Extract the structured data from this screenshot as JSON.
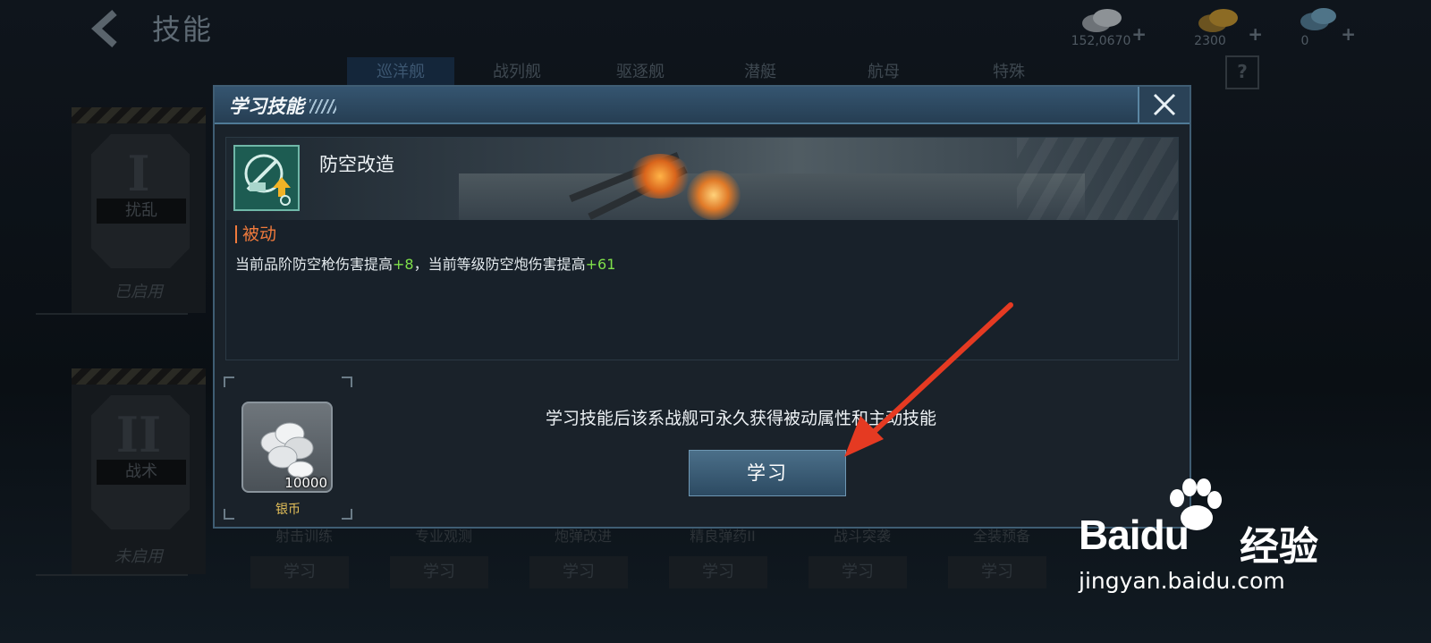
{
  "header": {
    "title": "技能",
    "currencies": [
      {
        "name": "silver",
        "amount": "152,0670",
        "plus": "+",
        "color": "#c7cacc"
      },
      {
        "name": "gold",
        "amount": "2300",
        "plus": "+",
        "color": "#d9a428"
      },
      {
        "name": "diamond",
        "amount": "0",
        "plus": "+",
        "color": "#7fb6d9"
      }
    ],
    "help_label": "?"
  },
  "ship_tabs": [
    "巡洋舰",
    "战列舰",
    "驱逐舰",
    "潜艇",
    "航母",
    "特殊"
  ],
  "active_tab": "巡洋舰",
  "tiers": [
    {
      "roman": "I",
      "name": "扰乱",
      "status": "已启用"
    },
    {
      "roman": "II",
      "name": "战术",
      "status": "未启用"
    }
  ],
  "bottom_cards": [
    {
      "name": "射击训练",
      "button": "学习"
    },
    {
      "name": "专业观测",
      "button": "学习"
    },
    {
      "name": "炮弹改进",
      "button": "学习"
    },
    {
      "name": "精良弹药II",
      "button": "学习"
    },
    {
      "name": "战斗突袭",
      "button": "学习"
    },
    {
      "name": "全装预备",
      "button": "学习"
    }
  ],
  "modal": {
    "title": "学习技能",
    "skill_name": "防空改造",
    "skill_type": "被动",
    "desc_part1": "当前品阶防空枪伤害提高",
    "desc_val1": "+8",
    "desc_part2": "，当前等级防空炮伤害提高",
    "desc_val2": "+61",
    "cost_amount": "10000",
    "cost_label": "银币",
    "learn_text": "学习技能后该系战舰可永久获得被动属性和主动技能",
    "learn_button": "学习"
  },
  "watermark": {
    "logo": "Bai",
    "logo_du": "du",
    "cn": "经验",
    "url": "jingyan.baidu.com"
  }
}
